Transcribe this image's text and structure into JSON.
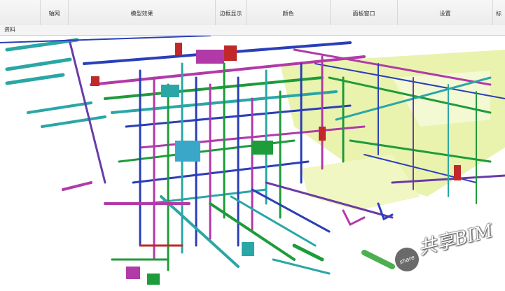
{
  "toolbar": {
    "axis_grid_label": "轴网",
    "model_effect_label": "模型效果",
    "edge_display_label": "边框显示",
    "color_label": "颜色",
    "panel_window_label": "面板窗口",
    "settings_label": "设置",
    "overflow_label": "标"
  },
  "subbar": {
    "label": "资料"
  },
  "watermark": {
    "text": "共享BIM",
    "badge": "share"
  },
  "colors": {
    "pipe_blue": "#2a3fb8",
    "pipe_magenta": "#b23aa8",
    "pipe_green": "#1e9b3a",
    "pipe_teal": "#2aa6a6",
    "pipe_red": "#c0282a",
    "floor_yellow": "#e6f2a0"
  }
}
